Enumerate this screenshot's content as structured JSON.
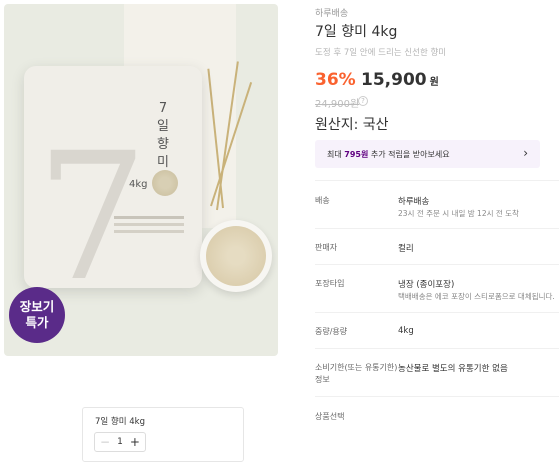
{
  "image": {
    "bag_title": "7일\n향미",
    "bag_weight": "4kg",
    "bag_big_numeral": "7",
    "promo_badge": "장보기\n특가"
  },
  "product": {
    "brand": "하루배송",
    "title": "7일 향미 4kg",
    "subtitle": "도정 후 7일 안에 드리는 신선한 향미",
    "discount": "36%",
    "price": "15,900",
    "price_unit": "원",
    "original_price": "24,900원",
    "origin": "원산지: 국산"
  },
  "reward": {
    "prefix": "최대 ",
    "points": "795원",
    "suffix": " 추가 적립을 받아보세요",
    "arrow": "›"
  },
  "details": {
    "delivery_label": "배송",
    "delivery_value": "하루배송",
    "delivery_sub": "23시 전 주문 시 내일 밤 12시 전 도착",
    "seller_label": "판매자",
    "seller_value": "컬리",
    "packaging_label": "포장타입",
    "packaging_value": "냉장 (종이포장)",
    "packaging_sub": "택배배송은 에코 포장이 스티로폼으로 대체됩니다.",
    "weight_label": "중량/용량",
    "weight_value": "4kg",
    "expiry_label": "소비기한(또는 유통기한)",
    "expiry_value": "농산물로 별도의 유통기한 없음",
    "expiry_label_2": "정보",
    "option_label": "상품선택"
  },
  "selector": {
    "name": "7일 향미 4kg",
    "quantity": "1",
    "minus": "−",
    "plus": "+"
  },
  "colors": {
    "discount": "#fa622f",
    "brand_purple": "#5f0080",
    "badge": "#5a2b89"
  }
}
